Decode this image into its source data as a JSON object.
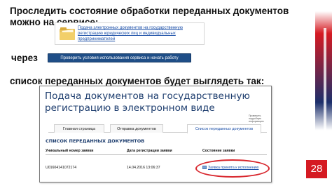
{
  "heading": "Проследить состояние обработки переданных документов можно на сервисе:",
  "link_box": {
    "link_text": "Подача электронных документов на государственную регистрацию юридических лиц и индивидуальных предпринимателей"
  },
  "via_label": "через",
  "check_button_label": "Проверить условия использования сервиса и начать работу",
  "list_heading": "список переданных документов будет выглядеть так:",
  "screenshot": {
    "title": "Подача документов на государственную регистрацию в электронном виде",
    "small_tag": "Проверить подробную информацию",
    "tabs": [
      "Главная страница",
      "Отправка документов",
      "Список переданных документов"
    ],
    "active_tab": 2,
    "list_title": "СПИСОК ПЕРЕДАННЫХ ДОКУМЕНТОВ",
    "columns": [
      "Уникальный номер заявки",
      "Дата регистрации заявки",
      "Состояние заявки"
    ],
    "rows": [
      {
        "id": "U01604141072174",
        "date": "14.04.2016 13:06:37",
        "status": "Заявка принята к исполнению"
      }
    ]
  },
  "page_number": "28",
  "colors": {
    "accent_red": "#d51a22",
    "navy": "#1f4e87",
    "link_blue": "#1b4fa8"
  },
  "icons": [
    "folder-icon",
    "document-status-icon"
  ]
}
